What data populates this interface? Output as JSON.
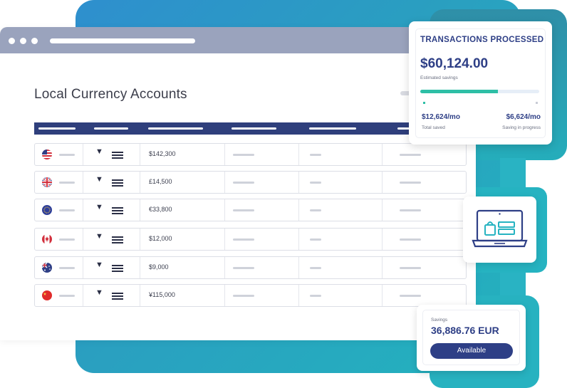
{
  "page": {
    "title": "Local Currency Accounts"
  },
  "accounts": [
    {
      "currency": "USD",
      "flag": "us-flag-icon",
      "amount": "$142,300"
    },
    {
      "currency": "GBP",
      "flag": "uk-flag-icon",
      "amount": "£14,500"
    },
    {
      "currency": "EUR",
      "flag": "eu-flag-icon",
      "amount": "€33,800"
    },
    {
      "currency": "CAD",
      "flag": "canada-flag-icon",
      "amount": "$12,000"
    },
    {
      "currency": "AUD",
      "flag": "australia-flag-icon",
      "amount": "$9,000"
    },
    {
      "currency": "CNY",
      "flag": "china-flag-icon",
      "amount": "¥115,000"
    }
  ],
  "transactions": {
    "title": "TRANSACTIONS PROCESSED",
    "amount": "$60,124.00",
    "amount_label": "Estimated savings",
    "progress": 0.65,
    "saved_value": "$12,624/mo",
    "saved_label": "Total saved",
    "progress_value": "$6,624/mo",
    "progress_label": "Saving in progress"
  },
  "savings": {
    "label": "Savings",
    "amount": "36,886.76 EUR",
    "button_label": "Available"
  },
  "icons": {
    "store": "laptop-shopping-icon"
  },
  "colors": {
    "accent": "#2e3f86",
    "teal": "#2ebfa6",
    "header": "#2f3f7c"
  }
}
